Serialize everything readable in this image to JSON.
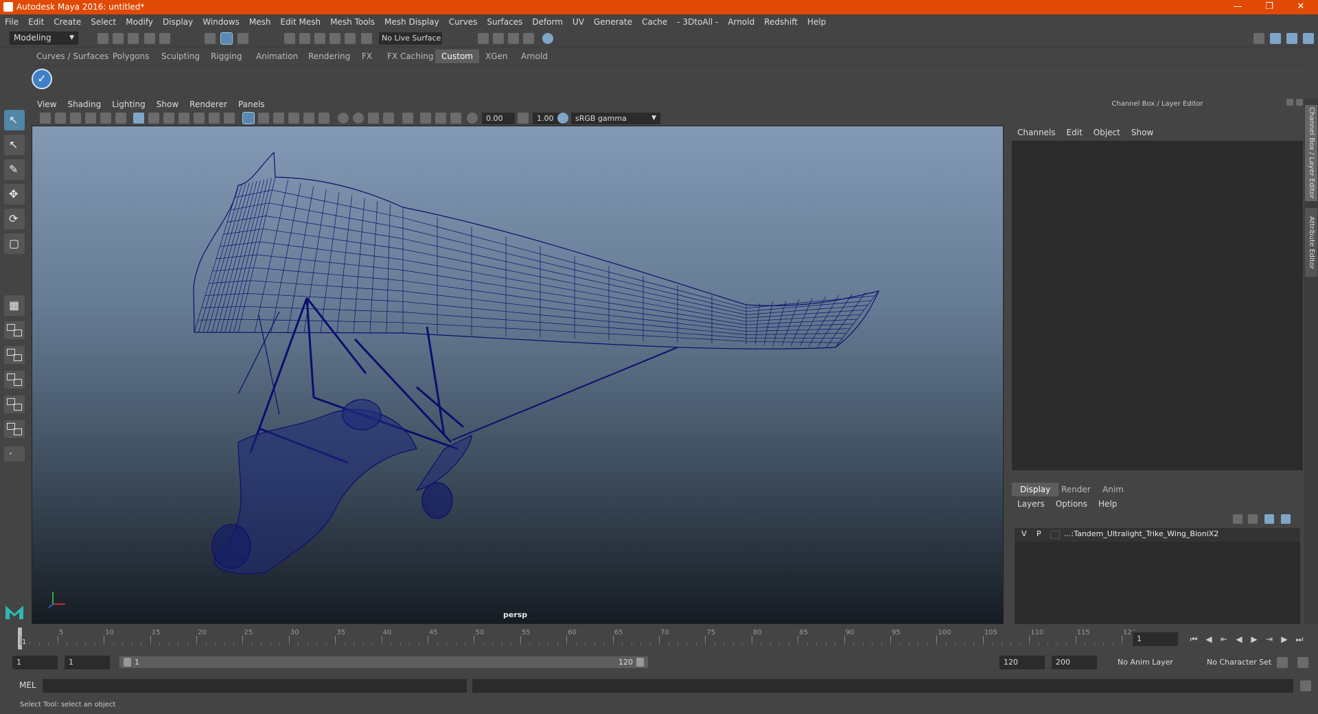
{
  "window": {
    "title": "Autodesk Maya 2016: untitled*"
  },
  "menubar": [
    "File",
    "Edit",
    "Create",
    "Select",
    "Modify",
    "Display",
    "Windows",
    "Mesh",
    "Edit Mesh",
    "Mesh Tools",
    "Mesh Display",
    "Curves",
    "Surfaces",
    "Deform",
    "UV",
    "Generate",
    "Cache",
    "- 3DtoAll -",
    "Arnold",
    "Redshift",
    "Help"
  ],
  "status_line": {
    "mode": "Modeling",
    "live_surface": "No Live Surface"
  },
  "shelf_tabs": [
    "Curves / Surfaces",
    "Polygons",
    "Sculpting",
    "Rigging",
    "Animation",
    "Rendering",
    "FX",
    "FX Caching",
    "Custom",
    "XGen",
    "Arnold"
  ],
  "shelf_active_tab": "Custom",
  "viewport": {
    "menu": [
      "View",
      "Shading",
      "Lighting",
      "Show",
      "Renderer",
      "Panels"
    ],
    "exposure": "0.00",
    "gamma_value": "1.00",
    "color_space": "sRGB gamma",
    "camera": "persp"
  },
  "channel_box": {
    "title": "Channel Box / Layer Editor",
    "menu": [
      "Channels",
      "Edit",
      "Object",
      "Show"
    ],
    "layer_tabs": [
      "Display",
      "Render",
      "Anim"
    ],
    "layer_menu": [
      "Layers",
      "Options",
      "Help"
    ],
    "layer": {
      "v": "V",
      "p": "P",
      "name": "...:Tandem_Ultralight_Trike_Wing_BioniX2"
    }
  },
  "side_tabs": [
    "Channel Box / Layer Editor",
    "Attribute Editor"
  ],
  "timeline": {
    "ticks": [
      "1",
      "5",
      "10",
      "15",
      "20",
      "25",
      "30",
      "35",
      "40",
      "45",
      "50",
      "55",
      "60",
      "65",
      "70",
      "75",
      "80",
      "85",
      "90",
      "95",
      "100",
      "105",
      "110",
      "115",
      "120"
    ],
    "current_frame": "1"
  },
  "range": {
    "start": "1",
    "playback_start": "1",
    "slider_start": "1",
    "slider_end": "120",
    "playback_end": "120",
    "end": "200",
    "anim_layer": "No Anim Layer",
    "character_set": "No Character Set"
  },
  "command_line": {
    "label": "MEL"
  },
  "help_line": "Select Tool: select an object",
  "colors": {
    "titlebar": "#e04a04",
    "wireframe": "#0d0d6e",
    "active_tool": "#5285a6"
  }
}
